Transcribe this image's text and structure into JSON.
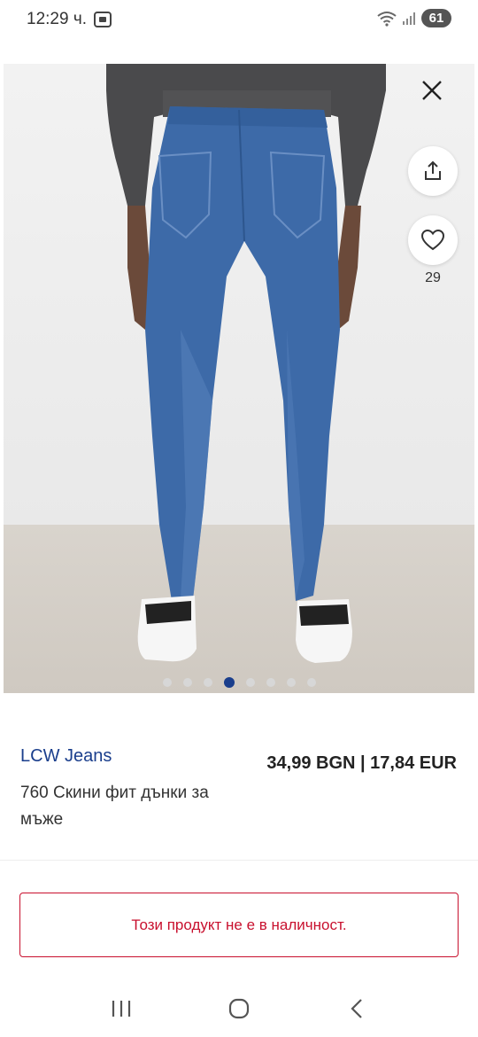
{
  "status_bar": {
    "time": "12:29 ч.",
    "battery": "61",
    "icons": [
      "screenshot-icon",
      "wifi-icon",
      "signal-icon"
    ]
  },
  "gallery": {
    "image_count": 8,
    "active_index": 3,
    "favorite_count": "29",
    "icons": [
      "close-icon",
      "share-icon",
      "heart-icon"
    ]
  },
  "product": {
    "brand": "LCW Jeans",
    "price": "34,99 BGN | 17,84 EUR",
    "title": "760 Скини фит дънки за мъже",
    "stock_message": "Този продукт не е в наличност."
  },
  "navigation": {
    "icons": [
      "recent-apps-icon",
      "home-icon",
      "back-icon"
    ]
  },
  "colors": {
    "brand_blue": "#1a3e8c",
    "alert_red": "#c8102e",
    "denim": "#3d6aa8"
  }
}
